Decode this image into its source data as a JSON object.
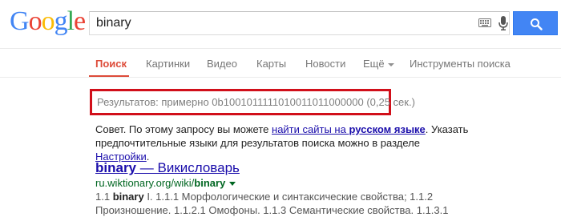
{
  "logo": {
    "letters": [
      "G",
      "o",
      "o",
      "g",
      "l",
      "e"
    ]
  },
  "search": {
    "query": "binary"
  },
  "tabs": [
    {
      "label": "Поиск",
      "active": true
    },
    {
      "label": "Картинки"
    },
    {
      "label": "Видео"
    },
    {
      "label": "Карты"
    },
    {
      "label": "Новости"
    },
    {
      "label": "Ещё"
    },
    {
      "label": "Инструменты поиска"
    }
  ],
  "result_stats": "Результатов: примерно 0b1001011111010011011000000 (0,25 сек.)",
  "advice": {
    "part1": "Совет. По этому запросу вы можете ",
    "link1_a": "найти сайты на ",
    "link1_b": "русском языке",
    "part2": ". Указать предпочтительные языки для результатов поиска можно в разделе ",
    "link2": "Настройки",
    "part3": "."
  },
  "result": {
    "title_bold": "binary",
    "title_rest": " — Викисловарь",
    "url_prefix": "ru.wiktionary.org/wiki/",
    "url_bold": "binary",
    "snippet_1": "1.1 ",
    "snippet_bold": "binary",
    "snippet_2": " I. 1.1.1 Морфологические и синтаксические свойства; 1.1.2 Произношение. 1.1.2.1 Омофоны. 1.1.3 Семантические свойства. 1.1.3.1"
  },
  "colors": {
    "accent_red": "#dd4b39",
    "link_blue": "#1a0dab",
    "url_green": "#006621",
    "search_button": "#4285f4",
    "highlight_box": "#d10f1a"
  }
}
